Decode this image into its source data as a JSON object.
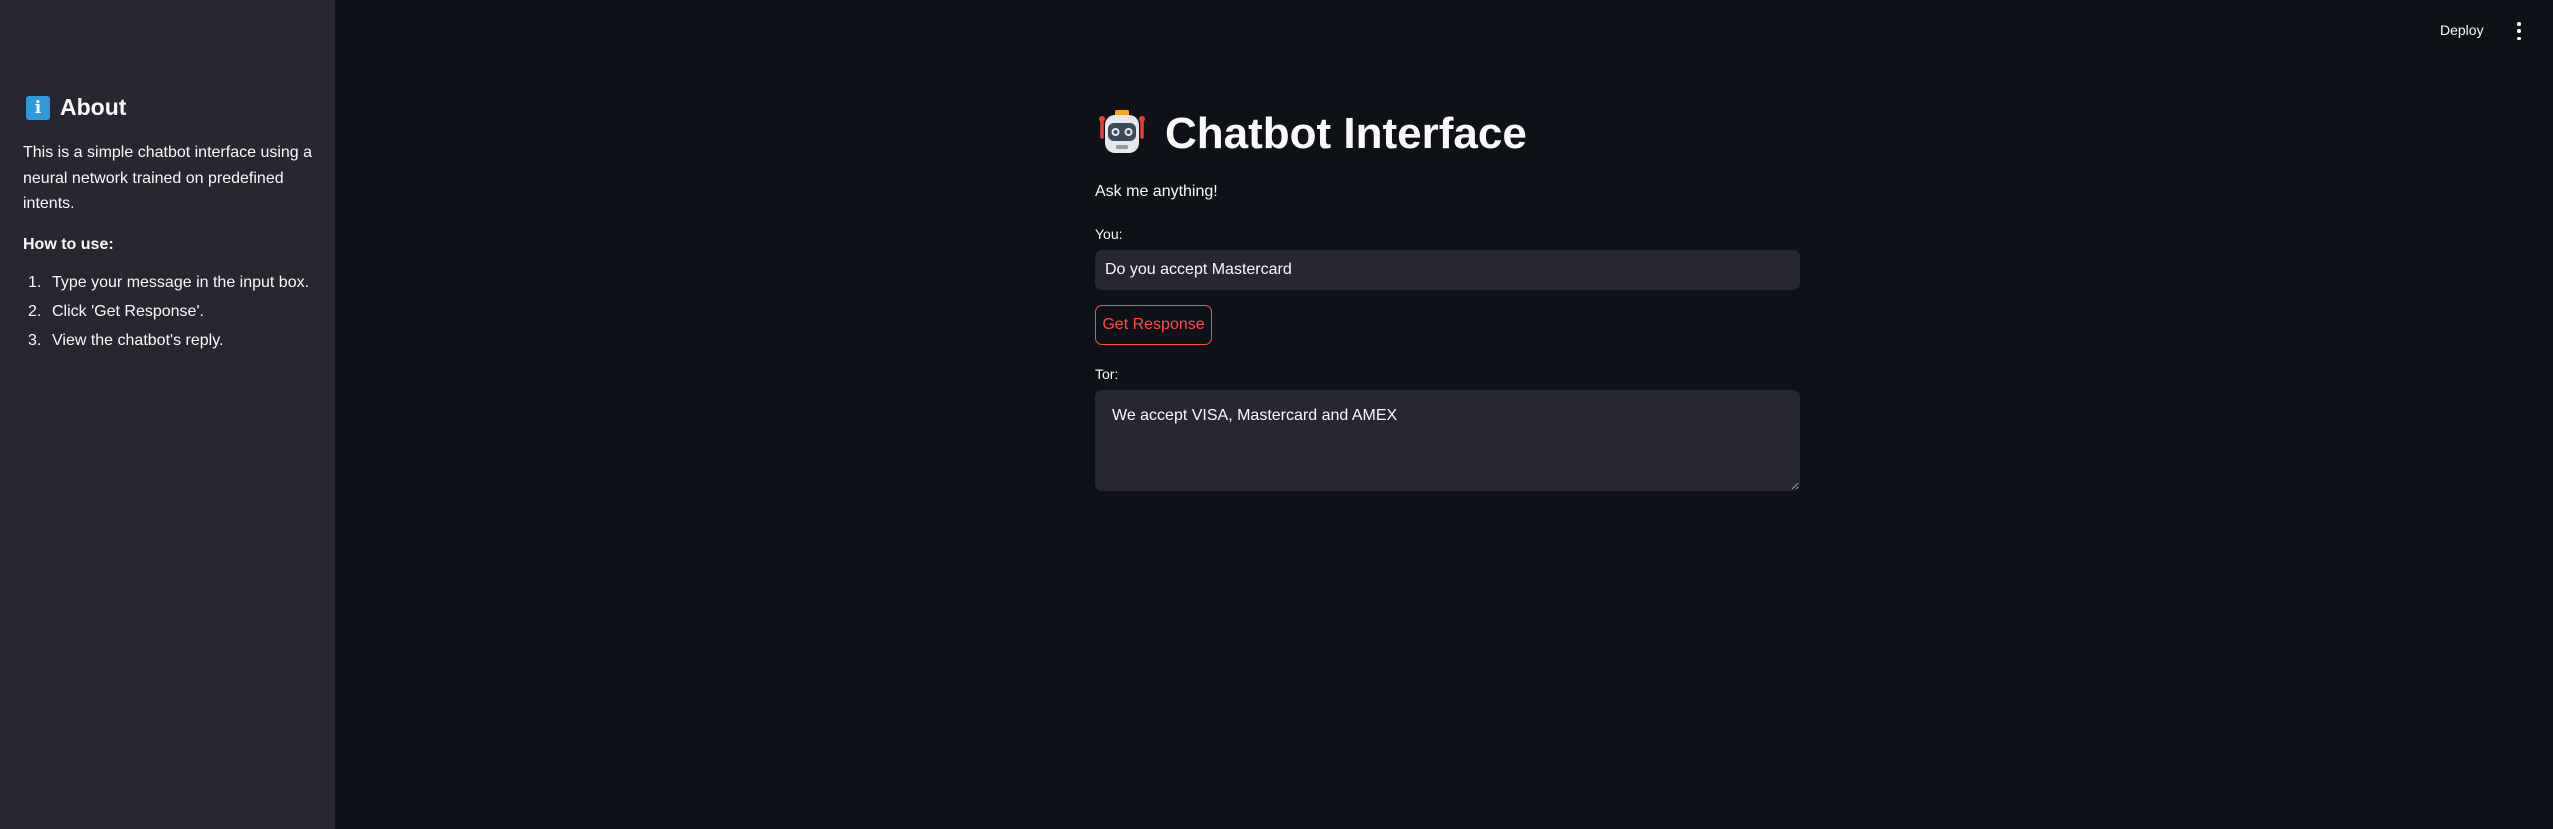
{
  "sidebar": {
    "title": "About",
    "icon": "info-icon",
    "description": "This is a simple chatbot interface using a neural network trained on predefined intents.",
    "howto_label": "How to use:",
    "steps": [
      {
        "num": "1.",
        "text": "Type your message in the input box."
      },
      {
        "num": "2.",
        "text": "Click 'Get Response'."
      },
      {
        "num": "3.",
        "text": "View the chatbot's reply."
      }
    ]
  },
  "header": {
    "deploy_label": "Deploy",
    "menu_icon": "more-vertical-icon"
  },
  "main": {
    "title": "Chatbot Interface",
    "title_icon": "robot-icon",
    "subtitle": "Ask me anything!",
    "input_label": "You:",
    "input_value": "Do you accept Mastercard",
    "button_label": "Get Response",
    "reply_label": "Tor:",
    "reply_value": "We accept VISA, Mastercard and AMEX"
  },
  "colors": {
    "background": "#0e1117",
    "sidebar": "#262730",
    "accent": "#ff4b4b",
    "text": "#fafafa",
    "info_blue": "#2e9be0"
  }
}
